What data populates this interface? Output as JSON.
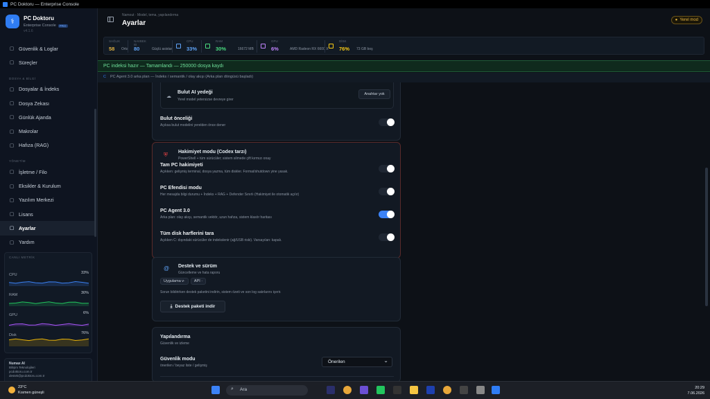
{
  "window": {
    "title": "PC Doktoru — Enterprise Console"
  },
  "brand": {
    "name": "PC Doktoru",
    "subtitle": "Enterprise Console",
    "badge": "PRO",
    "version": "v4.1.6"
  },
  "nav": {
    "items_top": [
      {
        "label": "Güvenlik & Loglar",
        "icon": "shield-icon"
      },
      {
        "label": "Süreçler",
        "icon": "process-icon"
      }
    ],
    "section_files": "DOSYA & BİLGİ",
    "items_files": [
      {
        "label": "Dosyalar & İndeks",
        "icon": "folder-icon"
      },
      {
        "label": "Dosya Zekası",
        "icon": "file-icon"
      },
      {
        "label": "Günlük Ajanda",
        "icon": "calendar-icon"
      },
      {
        "label": "Makrolar",
        "icon": "macro-icon"
      },
      {
        "label": "Hafıza (RAG)",
        "icon": "memory-icon"
      }
    ],
    "section_admin": "YÖNETİM",
    "items_admin": [
      {
        "label": "İşletme / Filo",
        "icon": "fleet-icon"
      },
      {
        "label": "Eksikler & Kurulum",
        "icon": "tools-icon"
      },
      {
        "label": "Yazılım Merkezi",
        "icon": "software-icon"
      },
      {
        "label": "Lisans",
        "icon": "key-icon"
      },
      {
        "label": "Ayarlar",
        "icon": "gear-icon",
        "active": true
      },
      {
        "label": "Yardım",
        "icon": "book-icon"
      }
    ]
  },
  "metrics": {
    "header": "CANLI METRİK",
    "rows": [
      {
        "label": "CPU",
        "value": "33%",
        "color": "#3b82f6",
        "level": 0.33
      },
      {
        "label": "RAM",
        "value": "30%",
        "color": "#22c55e",
        "level": 0.3
      },
      {
        "label": "GPU",
        "value": "6%",
        "color": "#a855f7",
        "level": 0.06
      },
      {
        "label": "Disk",
        "value": "76%",
        "color": "#eab308",
        "level": 0.76
      }
    ]
  },
  "company": {
    "name": "Numax AI",
    "line1": "Bilişim Teknolojileri",
    "line2": "pcdoktoru.com.tr",
    "line3": "destek@pcdoktoru.com.tr"
  },
  "header": {
    "breadcrumb": "Namout · Model, tema, yapılandırma",
    "title": "Ayarlar",
    "mode": "Yerel mod",
    "mode_color": "#e3b341"
  },
  "stats": [
    {
      "label": "SAĞLIK",
      "value": "58",
      "sub": "Orta",
      "color": "#e3b341"
    },
    {
      "label": "NAVBEK IB",
      "value": "80",
      "sub": "Güçlü asistan",
      "color": "#60a5fa"
    },
    {
      "label": "CPU",
      "value": "33%",
      "sub": "",
      "color": "#60a5fa"
    },
    {
      "label": "RAM",
      "value": "30%",
      "sub": "16672 MB",
      "color": "#4ade80"
    },
    {
      "label": "GPU",
      "value": "6%",
      "sub": "AMD Radeon RX 6600 X",
      "color": "#c084fc"
    },
    {
      "label": "DİSK",
      "value": "76%",
      "sub": "73 GB boş",
      "color": "#facc15"
    }
  ],
  "banner": "PC indeksi hazır — Tamamlandı — 250000 dosya kaydı",
  "agentbar": "PC Agent 3.0 arka plan — İndeks / semantik / olay akışı (Arka plan döngüsü başladı)",
  "cloud": {
    "title": "Bulut AI yedeği",
    "desc": "Yerel model yetersizse devreye girer",
    "button": "Anahtar yok",
    "priority_title": "Bulut önceliği",
    "priority_desc": "Açıksa bulut modelini yerelden önce dener"
  },
  "dominion": {
    "title": "Hakimiyet modu (Codex tarzı)",
    "desc": "PowerShell + tüm sürücüler; sistem silmede çift kırmızı onay",
    "rows": [
      {
        "title": "Tam PC hakimiyeti",
        "desc": "Açıkken: gelişmiş terminal, dosya yazma, tüm diskler. Format/shutdown yine yasak.",
        "on": false
      },
      {
        "title": "PC Efendisi modu",
        "desc": "Her mesajda bilgi durumu + İndeks + RAG + Defender Sınırlı (Hakimiyet ile otomatik açılır)",
        "on": false
      },
      {
        "title": "PC Agent 3.0",
        "desc": "Arka plan: olay akışı, semantik vektör, uzun hafıza, sistem klasör haritası",
        "on": true
      },
      {
        "title": "Tüm disk harflerini tara",
        "desc": "Açıkken C: dışındaki sürücüler de indekslenir (ağ/USB riski). Varsayılan: kapalı.",
        "on": false
      }
    ]
  },
  "support": {
    "title": "Destek ve sürüm",
    "desc": "Güncelleme ve hata raporu",
    "chips": [
      "Uygulama v·",
      "API ·"
    ],
    "note": "Sorun bildirirken destek paketini indirin, sistem özeti ve son log satırlarını içerir.",
    "button": "Destek paketi indir"
  },
  "config": {
    "title": "Yapılandırma",
    "desc": "Güvenlik ve izleme",
    "sec_title": "Güvenlik modu",
    "sec_desc": "önerilen / beyaz liste / gelişmiş",
    "select": "Önerilen"
  },
  "taskbar": {
    "temp": "23°C",
    "weather": "Kısmen güneşli",
    "search": "Ara",
    "time": "20:29",
    "date": "7.06.2026"
  }
}
